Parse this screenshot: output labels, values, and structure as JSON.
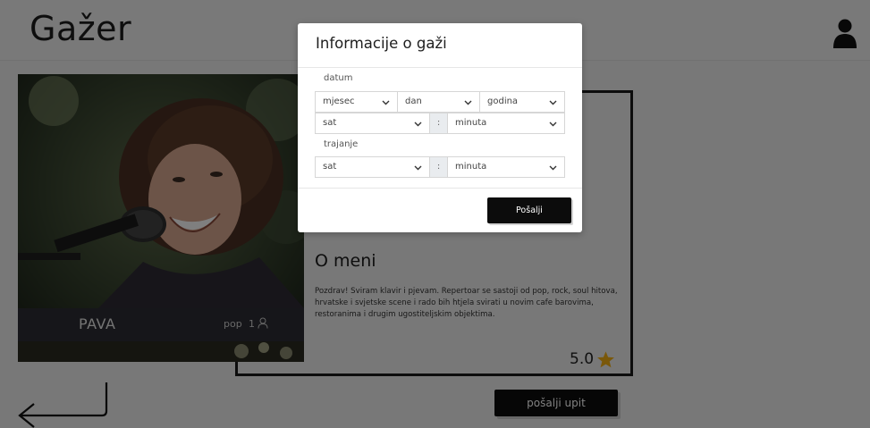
{
  "app": {
    "title": "Gažer"
  },
  "header": {
    "user_icon": "user-icon"
  },
  "profile": {
    "name": "PAVA",
    "genre": "pop",
    "member_count": "1",
    "about_title": "O meni",
    "about_text": "Pozdrav! Sviram klavir i pjevam. Repertoar se sastoji od pop, rock, soul hitova, hrvatske i svjetske scene i rado bih htjela svirati u novim cafe barovima, restoranima i drugim ugostiteljskim objektima.",
    "rating": "5.0",
    "send_inquiry_label": "pošalji upit"
  },
  "modal": {
    "title": "Informacije o gaži",
    "date_label": "datum",
    "month_value": "mjesec",
    "day_value": "dan",
    "year_value": "godina",
    "time_hour_value": "sat",
    "time_minute_value": "minuta",
    "colon": ":",
    "duration_label": "trajanje",
    "duration_hour_value": "sat",
    "duration_minute_value": "minuta",
    "submit_label": "Pošalji"
  },
  "colors": {
    "accent": "#0c0c0c",
    "star": "#f5b014",
    "overlay": "rgba(0,0,0,0.5)"
  }
}
